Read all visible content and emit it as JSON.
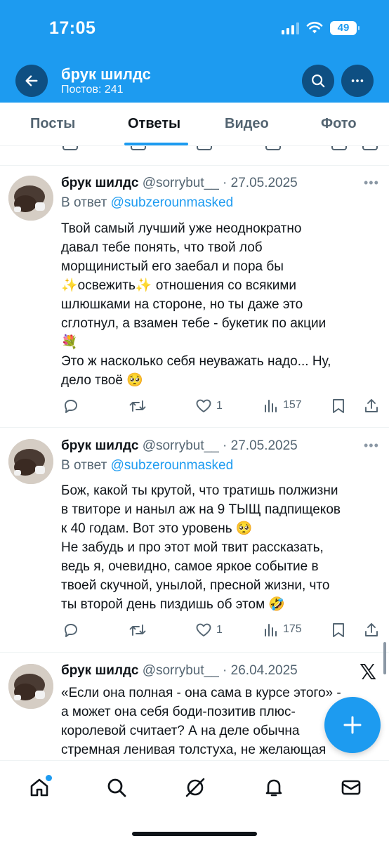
{
  "status_bar": {
    "time": "17:05",
    "battery": "49",
    "icons": [
      "signal-icon",
      "wifi-icon",
      "battery-icon"
    ]
  },
  "header": {
    "profile_name": "брук шилдс",
    "posts_count": "Постов: 241",
    "back_icon": "arrow-left-icon",
    "search_icon": "search-icon",
    "more_icon": "more-horizontal-icon",
    "background_color": "#1d9bf0"
  },
  "tabs": [
    {
      "label": "Посты",
      "active": false
    },
    {
      "label": "Ответы",
      "active": true
    },
    {
      "label": "Видео",
      "active": false
    },
    {
      "label": "Фото",
      "active": false
    }
  ],
  "tweets": [
    {
      "author": "брук шилдс",
      "handle": "@sorrybut__",
      "date": "· 27.05.2025",
      "reply_prefix": "В ответ",
      "reply_to": "@subzerounmasked",
      "text": "Твой самый лучший уже неоднократно\nдавал тебе понять, что твой лоб\nморщинистый его заебал и пора бы\n✨освежить✨ отношения со всякими\nшлюшками на стороне, но ты даже это\nсглотнул, а взамен тебе - букетик по акции\n💐\nЭто ж насколько себя неуважать надо... Ну,\nдело твоё 🥺",
      "likes": "1",
      "views": "157"
    },
    {
      "author": "брук шилдс",
      "handle": "@sorrybut__",
      "date": "· 27.05.2025",
      "reply_prefix": "В ответ",
      "reply_to": "@subzerounmasked",
      "text": "Бож, какой ты крутой, что тратишь полжизни\nв твиторе и наныл аж на 9 ТЫЩ падпищеков\nк 40 годам. Вот это уровень 🥺\nНе забудь и про этот мой твит рассказать,\nведь я, очевидно, самое яркое событие в\nтвоей скучной, унылой, пресной жизни, что\nты второй день пиздишь об этом 🤣",
      "likes": "1",
      "views": "175"
    },
    {
      "author": "брук шилдс",
      "handle": "@sorrybut__",
      "date": "· 26.04.2025",
      "text": "«Если она полная - она сама в курсе этого» -\nа может она себя боди-позитив плюс-\nкоролевой считает? А на деле обычна\nстремная ленивая толстуха, не желающая"
    }
  ],
  "x_logo": "𝕏",
  "fab_icon": "plus-icon",
  "bottom_nav": [
    {
      "icon": "home-icon",
      "has_notification_dot": true
    },
    {
      "icon": "search-icon"
    },
    {
      "icon": "grok-icon"
    },
    {
      "icon": "bell-icon"
    },
    {
      "icon": "mail-icon"
    }
  ],
  "colors": {
    "accent": "#1d9bf0",
    "text_primary": "#0f1419",
    "text_secondary": "#536471"
  }
}
